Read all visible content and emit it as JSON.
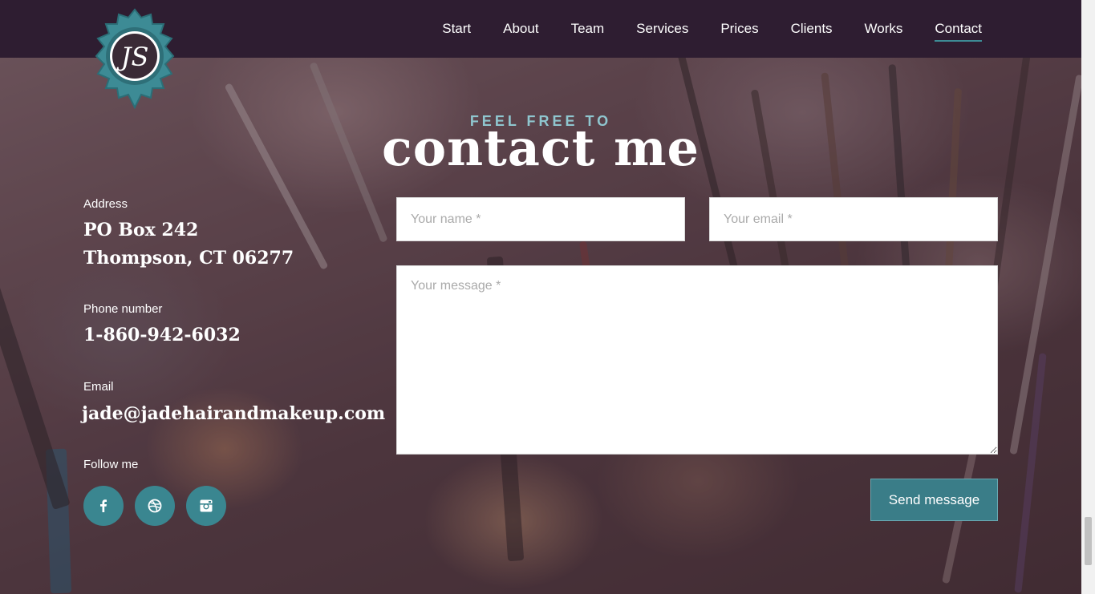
{
  "nav": {
    "items": [
      {
        "label": "Start"
      },
      {
        "label": "About"
      },
      {
        "label": "Team"
      },
      {
        "label": "Services"
      },
      {
        "label": "Prices"
      },
      {
        "label": "Clients"
      },
      {
        "label": "Works"
      },
      {
        "label": "Contact",
        "active": true
      }
    ]
  },
  "logo": {
    "monogram": "JS"
  },
  "hero": {
    "kicker": "FEEL FREE TO",
    "title": "contact me"
  },
  "contact": {
    "address_label": "Address",
    "address_line1": "PO Box 242",
    "address_line2": "Thompson, CT 06277",
    "phone_label": "Phone number",
    "phone": "1-860-942-6032",
    "email_label": "Email",
    "email": "jade@jadehairandmakeup.com",
    "follow_label": "Follow me"
  },
  "social": [
    {
      "icon": "facebook-icon"
    },
    {
      "icon": "dribbble-icon"
    },
    {
      "icon": "instagram-icon"
    }
  ],
  "form": {
    "name_placeholder": "Your name *",
    "email_placeholder": "Your email *",
    "message_placeholder": "Your message *",
    "send_label": "Send message"
  },
  "colors": {
    "topbar": "#2e1d31",
    "accent": "#3a8690",
    "kicker": "#8fc6cf"
  }
}
